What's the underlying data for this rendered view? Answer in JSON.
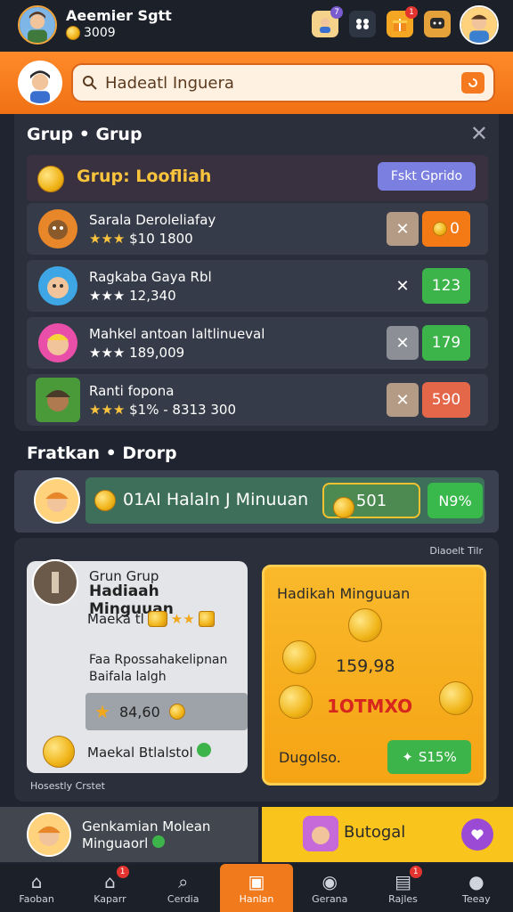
{
  "header": {
    "player_name": "Aeemier Sgtt",
    "coins": "3009",
    "badges": {
      "profile": "7",
      "gift": "1"
    }
  },
  "search": {
    "label": "Hadeatl Inguera"
  },
  "group": {
    "title": "Grup • Grup",
    "group_name": "Grup: Loofliah",
    "action_label": "Fskt Gprido",
    "members": [
      {
        "name": "Sarala Deroleliafay",
        "stars": "★★★",
        "stat": "$10 1800",
        "value": "0",
        "value_color": "#f47a16"
      },
      {
        "name": "Ragkaba Gaya Rbl",
        "stars": "★★★",
        "stat": "12,340",
        "value": "123",
        "value_color": "#3cb44a"
      },
      {
        "name": "Mahkel antoan laltlinueval",
        "stars": "★★★",
        "stat": "189,009",
        "value": "179",
        "value_color": "#3cb44a"
      },
      {
        "name": "Ranti fopona",
        "stars": "★★★",
        "stat": "$1%",
        "extra": "- 8313 300",
        "value": "590",
        "value_color": "#e5674a"
      }
    ]
  },
  "featured": {
    "title": "Fratkan • Drorp",
    "banner_text": "01AI Halaln J Minuuan",
    "coins": "501",
    "percent": "N9%"
  },
  "reward": {
    "tag": "Diaoelt Tilr",
    "card": {
      "subtitle": "Grun Grup",
      "title": "Hadiaah Minguuan",
      "line1": "Maeka tl",
      "line2": "Faa Rpossahakelipnan Baifala lalgh",
      "amount": "84,60",
      "bottom": "Maekal Btlalstol"
    },
    "gold": {
      "title": "Hadikah Minguuan",
      "amount1": "159,98",
      "amount2": "1OTMXO",
      "bottom": "Dugolso.",
      "button": "S15%"
    },
    "footer_tag": "Hosestly Crstet"
  },
  "strip": {
    "left_line1": "Genkamian Molean",
    "left_line2": "Minguaorl",
    "right_text": "Butogal"
  },
  "nav": [
    {
      "label": "Faoban",
      "icon": "⌂"
    },
    {
      "label": "Kaparr",
      "icon": "⌂",
      "badge": "1"
    },
    {
      "label": "Cerdia",
      "icon": "⌕"
    },
    {
      "label": "Hanlan",
      "icon": "▣"
    },
    {
      "label": "Gerana",
      "icon": "◉"
    },
    {
      "label": "Rajles",
      "icon": "▤",
      "badge": "1"
    },
    {
      "label": "Teeay",
      "icon": "●"
    }
  ],
  "colors": {
    "accent": "#f07a1c",
    "gold": "#f9c41c",
    "green": "#3cb44a",
    "panel": "#2a2f3b"
  }
}
